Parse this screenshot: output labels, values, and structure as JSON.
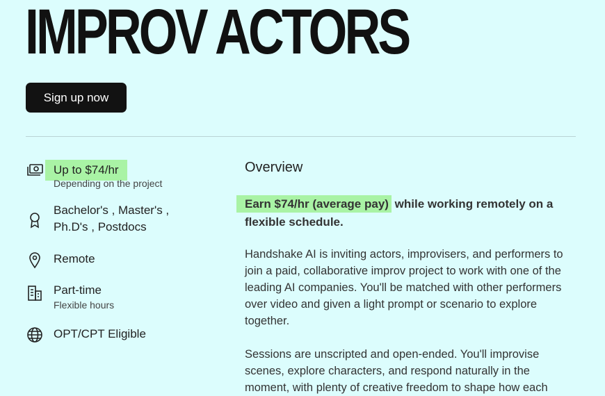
{
  "header": {
    "title": "IMPROV ACTORS",
    "signup_label": "Sign up now"
  },
  "details": {
    "pay": {
      "label": "Up to $74/hr",
      "sub": "Depending on the project",
      "icon": "money-icon"
    },
    "education": {
      "line1": "Bachelor's , Master's ,",
      "line2": "Ph.D's , Postdocs",
      "icon": "award-icon"
    },
    "location": {
      "label": "Remote",
      "icon": "location-pin-icon"
    },
    "schedule": {
      "label": "Part-time",
      "sub": "Flexible hours",
      "icon": "building-icon"
    },
    "eligibility": {
      "label": "OPT/CPT Eligible",
      "icon": "globe-icon"
    }
  },
  "main": {
    "heading": "Overview",
    "lead_highlight": "Earn $74/hr (average pay)",
    "lead_rest": " while working remotely on a flexible schedule.",
    "paragraph1": "Handshake AI is inviting actors, improvisers, and performers to join a paid, collaborative improv project to work with one of the leading AI companies. You'll be matched with other performers over video and given a light prompt or scenario to explore together.",
    "paragraph2": "Sessions are unscripted and open-ended. You'll improvise scenes, explore characters, and respond naturally in the moment, with plenty of creative freedom to shape how each"
  },
  "colors": {
    "background": "#dcfdfd",
    "highlight": "#a9f3a5",
    "button": "#121212"
  }
}
